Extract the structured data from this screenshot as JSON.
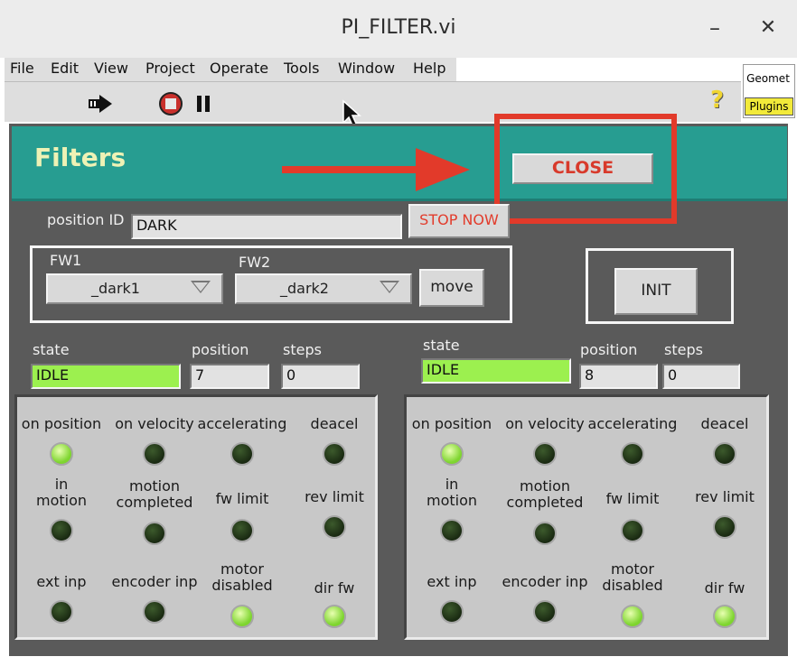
{
  "window": {
    "title": "PI_FILTER.vi",
    "minimize": "–",
    "close": "✕"
  },
  "menu": [
    "File",
    "Edit",
    "View",
    "Project",
    "Operate",
    "Tools",
    "Window",
    "Help"
  ],
  "toolbar": {
    "run_icon": "run-arrow-icon",
    "stop_icon": "abort-stop-icon",
    "pause_icon": "pause-icon",
    "help": "?",
    "geomet": "Geomet",
    "plugins": "Plugins"
  },
  "panel": {
    "title": "Filters",
    "close_label": "CLOSE",
    "stop_label": "STOP NOW",
    "init_label": "INIT",
    "position_id_label": "position ID",
    "position_id_value": "DARK",
    "fw1_label": "FW1",
    "fw1_value": "_dark1",
    "fw2_label": "FW2",
    "fw2_value": "_dark2",
    "move_label": "move"
  },
  "axes": [
    {
      "state_label": "state",
      "state_value": "IDLE",
      "position_label": "position",
      "position_value": "7",
      "steps_label": "steps",
      "steps_value": "0",
      "leds": [
        {
          "label": "on position",
          "on": true
        },
        {
          "label": "on velocity",
          "on": false
        },
        {
          "label": "accelerating",
          "on": false
        },
        {
          "label": "deacel",
          "on": false
        },
        {
          "label": "in\nmotion",
          "on": false
        },
        {
          "label": "motion\ncompleted",
          "on": false
        },
        {
          "label": "fw limit",
          "on": false
        },
        {
          "label": "rev limit",
          "on": false
        },
        {
          "label": "ext inp",
          "on": false
        },
        {
          "label": "encoder inp",
          "on": false
        },
        {
          "label": "motor\ndisabled",
          "on": true
        },
        {
          "label": "dir fw",
          "on": true
        }
      ]
    },
    {
      "state_label": "state",
      "state_value": "IDLE",
      "position_label": "position",
      "position_value": "8",
      "steps_label": "steps",
      "steps_value": "0",
      "leds": [
        {
          "label": "on position",
          "on": true
        },
        {
          "label": "on velocity",
          "on": false
        },
        {
          "label": "accelerating",
          "on": false
        },
        {
          "label": "deacel",
          "on": false
        },
        {
          "label": "in\nmotion",
          "on": false
        },
        {
          "label": "motion\ncompleted",
          "on": false
        },
        {
          "label": "fw limit",
          "on": false
        },
        {
          "label": "rev limit",
          "on": false
        },
        {
          "label": "ext inp",
          "on": false
        },
        {
          "label": "encoder inp",
          "on": false
        },
        {
          "label": "motor\ndisabled",
          "on": true
        },
        {
          "label": "dir fw",
          "on": true
        }
      ]
    }
  ],
  "colors": {
    "banner": "#279d91",
    "title_text": "#eef2b5",
    "close_text": "#d83a2b",
    "highlight": "#e23a2a",
    "state_field": "#9cf04f",
    "led_on": "#7ed52f",
    "led_off": "#1a2a12"
  }
}
